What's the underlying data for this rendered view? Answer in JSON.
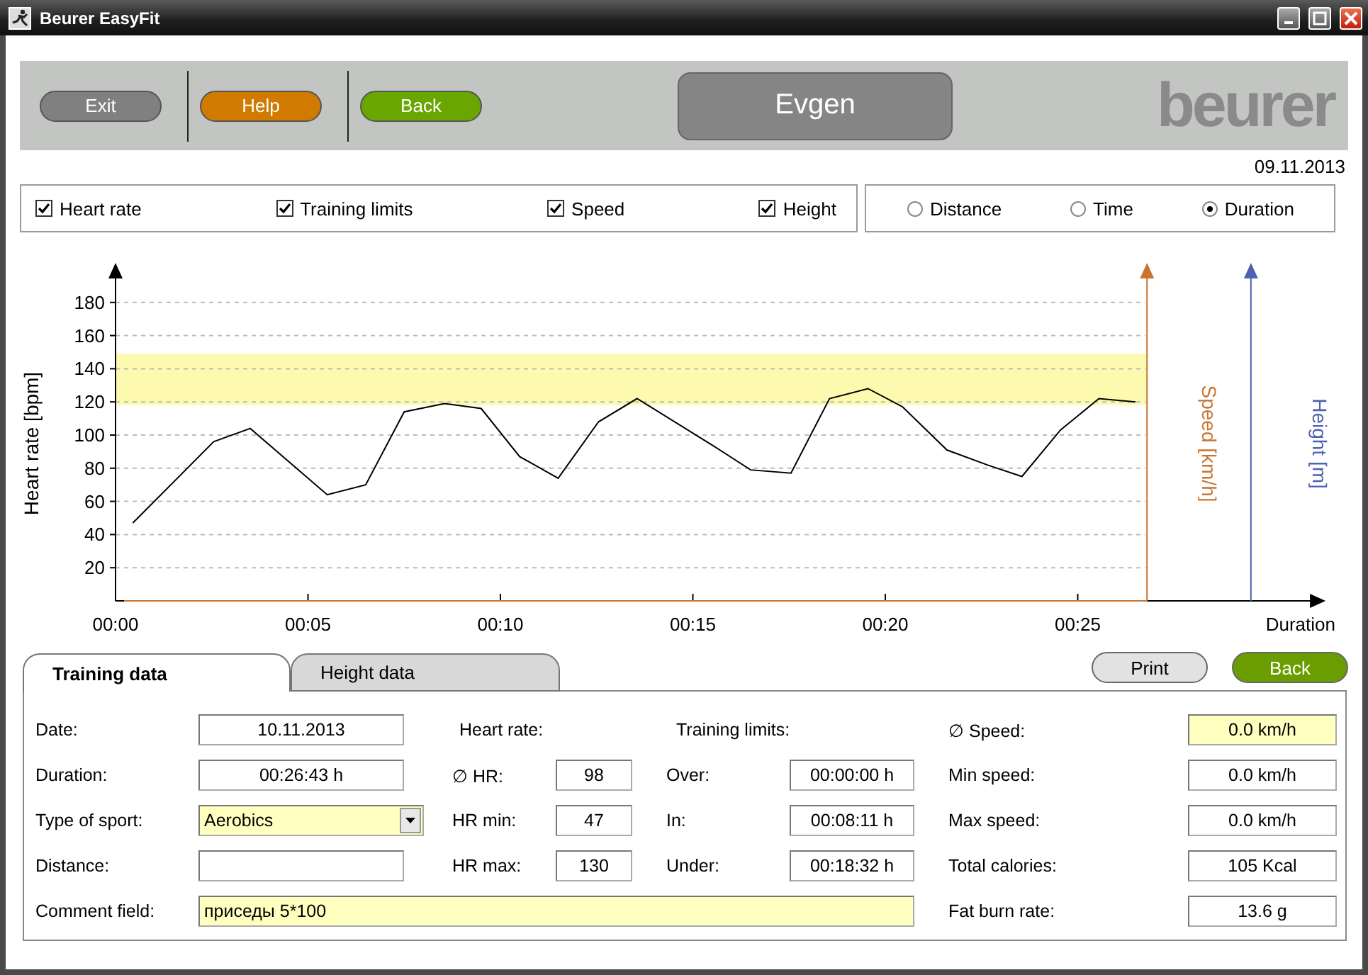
{
  "window": {
    "title": "Beurer EasyFit"
  },
  "header": {
    "buttons": [
      {
        "label": "Exit",
        "color": "#808080"
      },
      {
        "label": "Help",
        "color": "#d07a00"
      },
      {
        "label": "Back",
        "color": "#6aa600"
      }
    ],
    "user_name": "Evgen",
    "logo": "beurer"
  },
  "date": "09.11.2013",
  "display_options": [
    {
      "label": "Heart rate",
      "checked": true
    },
    {
      "label": "Training limits",
      "checked": true
    },
    {
      "label": "Speed",
      "checked": true
    },
    {
      "label": "Height",
      "checked": true
    }
  ],
  "x_axis_modes": [
    {
      "label": "Distance",
      "selected": false
    },
    {
      "label": "Time",
      "selected": false
    },
    {
      "label": "Duration",
      "selected": true
    }
  ],
  "chart": {
    "secondary_axes": [
      {
        "label": "Speed [km/h]",
        "color": "#c87533"
      },
      {
        "label": "Height [m]",
        "color": "#4f62b0"
      }
    ],
    "chart_data": {
      "type": "line",
      "xlabel": "Duration",
      "ylabel": "Heart rate [bpm]",
      "ylim": [
        0,
        197
      ],
      "xlim": [
        0,
        31.07
      ],
      "grid": true,
      "xticks": [
        {
          "value": 0,
          "label": "00:00"
        },
        {
          "value": 5,
          "label": "00:05"
        },
        {
          "value": 10,
          "label": "00:10"
        },
        {
          "value": 15,
          "label": "00:15"
        },
        {
          "value": 20,
          "label": "00:20"
        },
        {
          "value": 25,
          "label": "00:25"
        }
      ],
      "yticks": [
        20,
        40,
        60,
        80,
        100,
        120,
        140,
        160,
        180
      ],
      "x": [
        0.45,
        2.55,
        3.5,
        5.5,
        6.5,
        7.5,
        8.55,
        9.5,
        10.5,
        11.5,
        12.55,
        13.55,
        15.5,
        16.5,
        17.55,
        18.55,
        19.55,
        20.45,
        21.6,
        22.65,
        23.55,
        24.55,
        25.55,
        26.5
      ],
      "series": [
        {
          "color": "#000000",
          "values": [
            47,
            96,
            104,
            64,
            70,
            114,
            119,
            116,
            87,
            74,
            108,
            122,
            94,
            79,
            77,
            122,
            128,
            117,
            91,
            82,
            75,
            103,
            122,
            120
          ]
        }
      ],
      "bands": [
        {
          "axis": "y",
          "from": 118,
          "to": 149,
          "color": "#fdfab0"
        }
      ],
      "ref_lines": [
        {
          "axis": "x",
          "value": 26.8,
          "color": "#c87533"
        },
        {
          "axis": "x",
          "value": 29.5,
          "color": "#4f62b0"
        }
      ]
    }
  },
  "tabs": [
    {
      "label": "Training data",
      "selected": true
    },
    {
      "label": "Height data",
      "selected": false
    }
  ],
  "actions": [
    {
      "label": "Print",
      "color": "#e2e2e2"
    },
    {
      "label": "Back",
      "color": "#6a9e00"
    }
  ],
  "training_data": {
    "general": [
      {
        "label": "Date:",
        "value": "10.11.2013",
        "kind": "text",
        "highlighted": false
      },
      {
        "label": "Duration:",
        "value": "00:26:43 h",
        "kind": "text",
        "highlighted": false
      },
      {
        "label": "Type of sport:",
        "value": "Aerobics",
        "kind": "dropdown",
        "highlighted": true
      },
      {
        "label": "Distance:",
        "kind": "text",
        "highlighted": false
      }
    ],
    "comment": {
      "label": "Comment field:",
      "value": "приседы 5*100",
      "highlighted": true
    },
    "heart_rate": {
      "heading": "Heart rate:",
      "rows": [
        {
          "symbol": "∅",
          "label": "HR:",
          "value": "98"
        },
        {
          "label": "HR min:",
          "value": "47"
        },
        {
          "label": "HR max:",
          "value": "130"
        }
      ]
    },
    "training_limits": {
      "heading": "Training limits:",
      "rows": [
        {
          "label": "Over:",
          "value": "00:00:00 h"
        },
        {
          "label": "In:",
          "value": "00:08:11 h"
        },
        {
          "label": "Under:",
          "value": "00:18:32 h"
        }
      ]
    },
    "speed_stats": [
      {
        "symbol": "∅",
        "label": "Speed:",
        "value": "0.0 km/h",
        "highlighted": true
      },
      {
        "label": "Min speed:",
        "value": "0.0 km/h",
        "highlighted": false
      },
      {
        "label": "Max speed:",
        "value": "0.0 km/h",
        "highlighted": false
      },
      {
        "label": "Total calories:",
        "value": "105 Kcal",
        "highlighted": false
      },
      {
        "label": "Fat burn rate:",
        "value": "13.6 g",
        "highlighted": false
      }
    ]
  }
}
